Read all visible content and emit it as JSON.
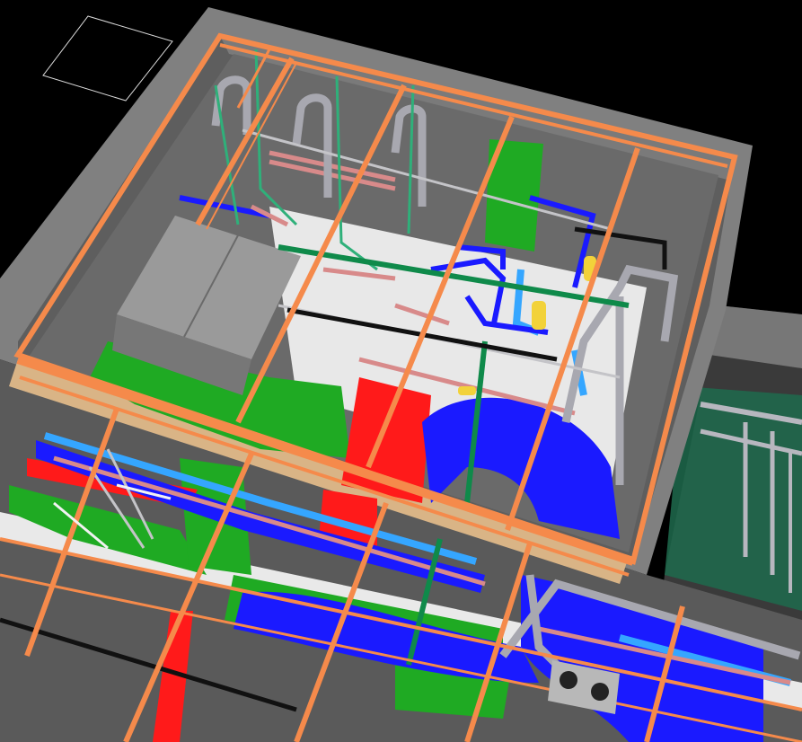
{
  "scene": {
    "view": "3d-isometric-mep-model",
    "colors": {
      "background": "#000000",
      "room_floor": "#6f6f6f",
      "room_wall": "#8a8a8a",
      "room_wall_dark": "#5c5c5c",
      "steel_frame": "#f58a4b",
      "duct_green": "#1faa23",
      "duct_red": "#ff1a1a",
      "duct_blue": "#1a1aff",
      "pipe_light_blue": "#35a6ff",
      "pipe_gray": "#a8a8b0",
      "pipe_pink": "#d88a8a",
      "pipe_yellow": "#f2d23a",
      "equipment_gray": "#9a9a9a",
      "glass_green": "#1e6b4d",
      "tan_panel": "#d9b486",
      "white_panel": "#e9e9e9"
    }
  }
}
